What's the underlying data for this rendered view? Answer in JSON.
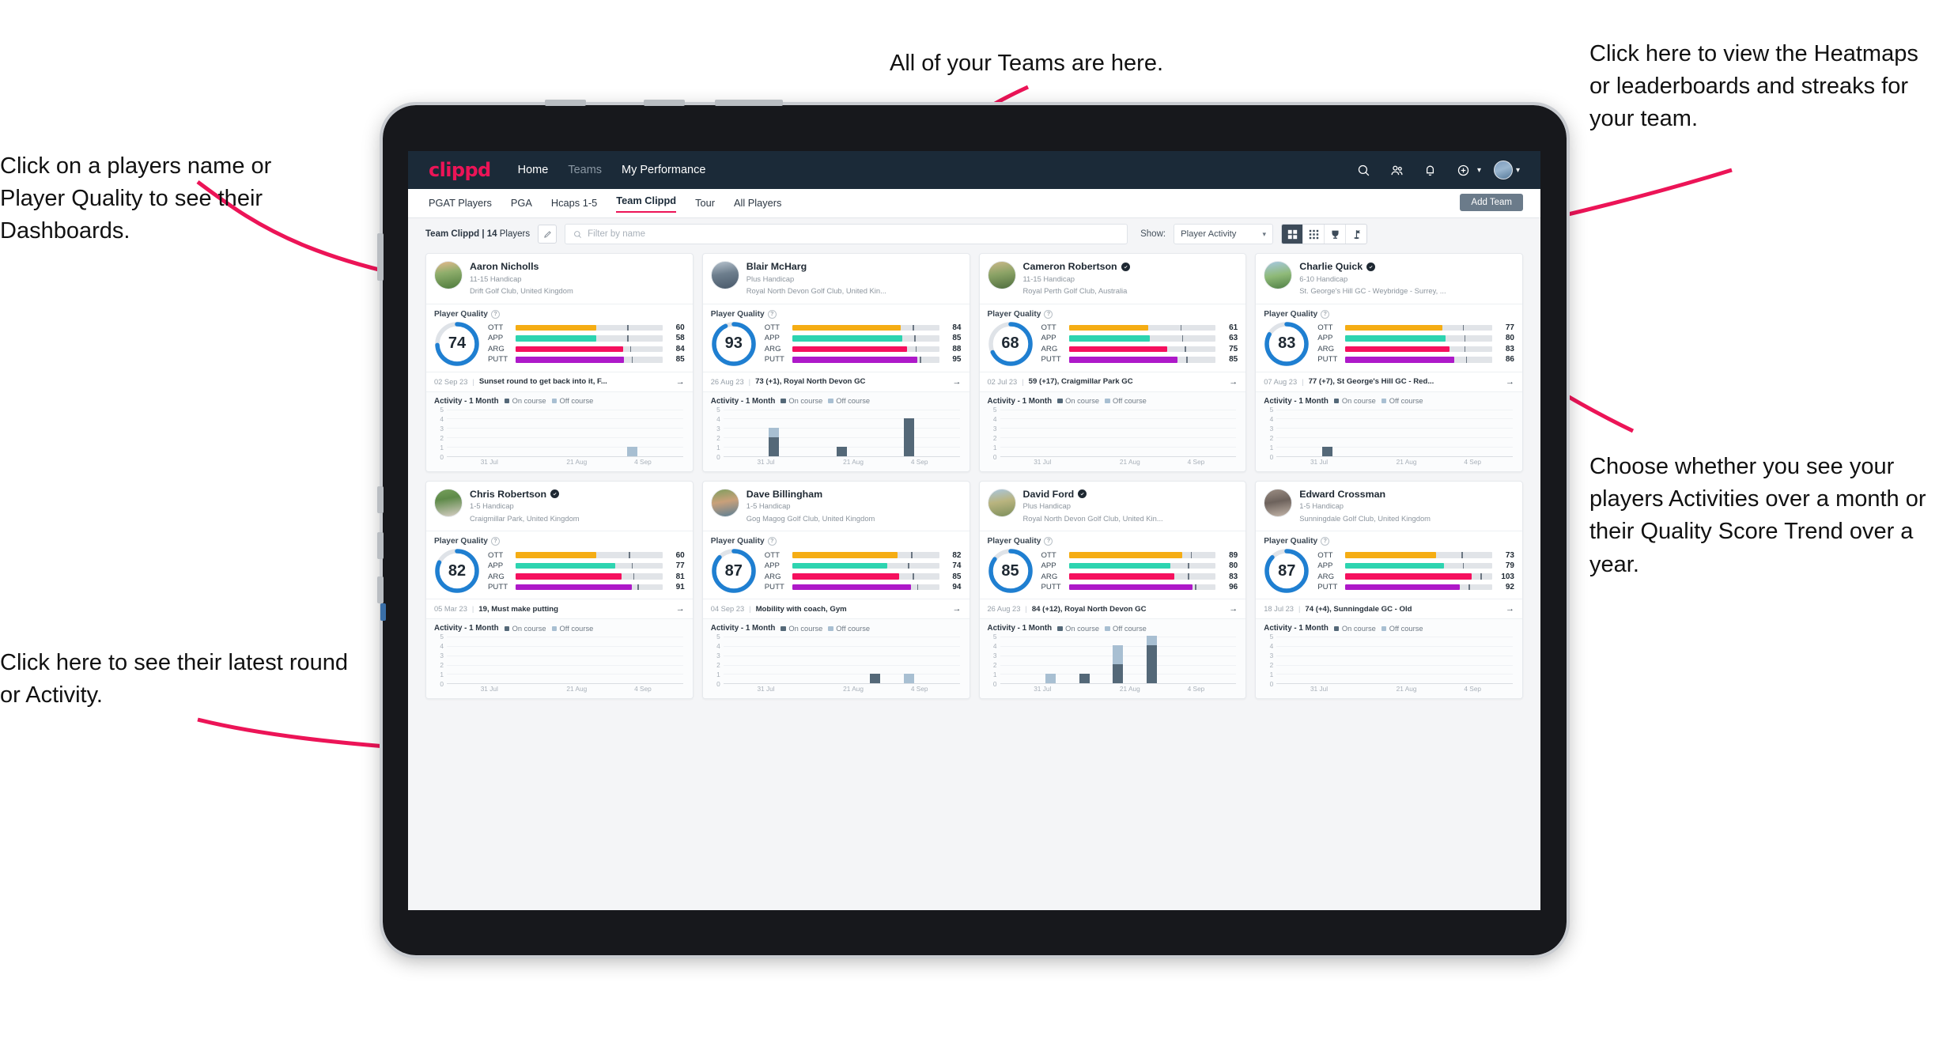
{
  "annotations": {
    "players_name": "Click on a players name or Player Quality to see their Dashboards.",
    "teams": "All of your Teams are here.",
    "heatmaps": "Click here to view the Heatmaps or leaderboards and streaks for your team.",
    "activity_choice": "Choose whether you see your players Activities over a month or their Quality Score Trend over a year.",
    "latest_round": "Click here to see their latest round or Activity."
  },
  "app": {
    "logo": "clippd",
    "nav": [
      {
        "label": "Home",
        "active": true
      },
      {
        "label": "Teams",
        "active": false
      },
      {
        "label": "My Performance",
        "active": true
      }
    ],
    "nav_icons": [
      "search-icon",
      "people-icon",
      "bell-icon",
      "plus-circle-icon",
      "avatar"
    ],
    "subtabs": [
      {
        "label": "PGAT Players",
        "state": "normal"
      },
      {
        "label": "PGA",
        "state": "normal"
      },
      {
        "label": "Hcaps 1-5",
        "state": "normal"
      },
      {
        "label": "Team Clippd",
        "state": "active"
      },
      {
        "label": "Tour",
        "state": "normal"
      },
      {
        "label": "All Players",
        "state": "normal"
      }
    ],
    "add_team_label": "Add Team"
  },
  "toolbar": {
    "team_label_bold": "Team Clippd | 14",
    "team_label_rest": " Players",
    "edit_icon": "pencil-icon",
    "search_placeholder": "Filter by name",
    "show_label": "Show:",
    "show_value": "Player Activity",
    "view_buttons": [
      "grid-large-icon",
      "grid-small-icon",
      "trophy-icon",
      "golf-flag-icon"
    ]
  },
  "card_labels": {
    "player_quality": "Player Quality",
    "activity_title": "Activity - 1 Month",
    "legend_on": "On course",
    "legend_off": "Off course",
    "metric_names": [
      "OTT",
      "APP",
      "ARG",
      "PUTT"
    ],
    "x_ticks": [
      "31 Jul",
      "21 Aug",
      "4 Sep"
    ],
    "y_ticks": [
      "5",
      "4",
      "3",
      "2",
      "1",
      "0"
    ]
  },
  "colors": {
    "brand_pink": "#ec1457",
    "nav_dark": "#1b2a38",
    "ring_blue": "#1f7fd1",
    "ott": "#f5ad14",
    "app": "#2dd4b0",
    "arg": "#f5105e",
    "putt": "#ae19c9",
    "on_course": "#546878",
    "off_course": "#a8bfd2",
    "annotation_arrow": "#ec1457"
  },
  "players": [
    {
      "name": "Aaron Nicholls",
      "verified": false,
      "handicap": "11-15 Handicap",
      "club": "Drift Golf Club, United Kingdom",
      "quality": 74,
      "metrics": [
        {
          "name": "OTT",
          "value": 60,
          "fill": 55,
          "tick": 76
        },
        {
          "name": "APP",
          "value": 58,
          "fill": 55,
          "tick": 76
        },
        {
          "name": "ARG",
          "value": 84,
          "fill": 73,
          "tick": 78
        },
        {
          "name": "PUTT",
          "value": 85,
          "fill": 74,
          "tick": 79
        }
      ],
      "round": {
        "date": "02 Sep 23",
        "text": "Sunset round to get back into it, F..."
      },
      "activity": {
        "on": [
          0,
          0,
          0,
          0,
          0,
          0,
          0
        ],
        "off": [
          0,
          0,
          0,
          0,
          0,
          1,
          0
        ]
      },
      "avatar": "linear-gradient(170deg,#e7b98e 0%,#8fae6c 40%,#4d7a3c 100%)"
    },
    {
      "name": "Blair McHarg",
      "verified": false,
      "handicap": "Plus Handicap",
      "club": "Royal North Devon Golf Club, United Kin...",
      "quality": 93,
      "metrics": [
        {
          "name": "OTT",
          "value": 84,
          "fill": 74,
          "tick": 82
        },
        {
          "name": "APP",
          "value": 85,
          "fill": 75,
          "tick": 83
        },
        {
          "name": "ARG",
          "value": 88,
          "fill": 78,
          "tick": 84
        },
        {
          "name": "PUTT",
          "value": 95,
          "fill": 85,
          "tick": 87
        }
      ],
      "round": {
        "date": "26 Aug 23",
        "text": "73 (+1), Royal North Devon GC"
      },
      "activity": {
        "on": [
          0,
          2,
          0,
          1,
          0,
          4,
          0
        ],
        "off": [
          0,
          1,
          0,
          0,
          0,
          0,
          0
        ]
      },
      "avatar": "linear-gradient(170deg,#b8c4cf 0%,#6d7e8d 45%,#49596a 100%)"
    },
    {
      "name": "Cameron Robertson",
      "verified": true,
      "handicap": "11-15 Handicap",
      "club": "Royal Perth Golf Club, Australia",
      "quality": 68,
      "metrics": [
        {
          "name": "OTT",
          "value": 61,
          "fill": 54,
          "tick": 76
        },
        {
          "name": "APP",
          "value": 63,
          "fill": 55,
          "tick": 77
        },
        {
          "name": "ARG",
          "value": 75,
          "fill": 67,
          "tick": 79
        },
        {
          "name": "PUTT",
          "value": 85,
          "fill": 74,
          "tick": 80
        }
      ],
      "round": {
        "date": "02 Jul 23",
        "text": "59 (+17), Craigmillar Park GC"
      },
      "activity": {
        "on": [
          0,
          0,
          0,
          0,
          0,
          0,
          0
        ],
        "off": [
          0,
          0,
          0,
          0,
          0,
          0,
          0
        ]
      },
      "avatar": "linear-gradient(170deg,#cbb98a 0%,#8aa265 45%,#4e6d3e 100%)"
    },
    {
      "name": "Charlie Quick",
      "verified": true,
      "handicap": "6-10 Handicap",
      "club": "St. George's Hill GC - Weybridge - Surrey, ...",
      "quality": 83,
      "metrics": [
        {
          "name": "OTT",
          "value": 77,
          "fill": 66,
          "tick": 80
        },
        {
          "name": "APP",
          "value": 80,
          "fill": 68,
          "tick": 81
        },
        {
          "name": "ARG",
          "value": 83,
          "fill": 71,
          "tick": 81
        },
        {
          "name": "PUTT",
          "value": 86,
          "fill": 74,
          "tick": 82
        }
      ],
      "round": {
        "date": "07 Aug 23",
        "text": "77 (+7), St George's Hill GC - Red..."
      },
      "activity": {
        "on": [
          0,
          1,
          0,
          0,
          0,
          0,
          0
        ],
        "off": [
          0,
          0,
          0,
          0,
          0,
          0,
          0
        ]
      },
      "avatar": "linear-gradient(170deg,#a7c9e3 0%,#8fba78 50%,#4f7f45 100%)"
    },
    {
      "name": "Chris Robertson",
      "verified": true,
      "handicap": "1-5 Handicap",
      "club": "Craigmillar Park, United Kingdom",
      "quality": 82,
      "metrics": [
        {
          "name": "OTT",
          "value": 60,
          "fill": 55,
          "tick": 77
        },
        {
          "name": "APP",
          "value": 77,
          "fill": 68,
          "tick": 79
        },
        {
          "name": "ARG",
          "value": 81,
          "fill": 72,
          "tick": 80
        },
        {
          "name": "PUTT",
          "value": 91,
          "fill": 79,
          "tick": 83
        }
      ],
      "round": {
        "date": "05 Mar 23",
        "text": "19, Must make putting"
      },
      "activity": {
        "on": [
          0,
          0,
          0,
          0,
          0,
          0,
          0
        ],
        "off": [
          0,
          0,
          0,
          0,
          0,
          0,
          0
        ]
      },
      "avatar": "linear-gradient(170deg,#77a05c 0%,#5e8a49 35%,#d8cfc6 100%)"
    },
    {
      "name": "Dave Billingham",
      "verified": false,
      "handicap": "1-5 Handicap",
      "club": "Gog Magog Golf Club, United Kingdom",
      "quality": 87,
      "metrics": [
        {
          "name": "OTT",
          "value": 82,
          "fill": 72,
          "tick": 81
        },
        {
          "name": "APP",
          "value": 74,
          "fill": 65,
          "tick": 79
        },
        {
          "name": "ARG",
          "value": 85,
          "fill": 73,
          "tick": 82
        },
        {
          "name": "PUTT",
          "value": 94,
          "fill": 81,
          "tick": 85
        }
      ],
      "round": {
        "date": "04 Sep 23",
        "text": "Mobility with coach, Gym"
      },
      "activity": {
        "on": [
          0,
          0,
          0,
          0,
          1,
          0,
          0
        ],
        "off": [
          0,
          0,
          0,
          0,
          0,
          1,
          0
        ]
      },
      "avatar": "linear-gradient(170deg,#7f9e5e 0%,#c9a07a 45%,#5b7f94 100%)"
    },
    {
      "name": "David Ford",
      "verified": true,
      "handicap": "Plus Handicap",
      "club": "Royal North Devon Golf Club, United Kin...",
      "quality": 85,
      "metrics": [
        {
          "name": "OTT",
          "value": 89,
          "fill": 77,
          "tick": 83
        },
        {
          "name": "APP",
          "value": 80,
          "fill": 69,
          "tick": 81
        },
        {
          "name": "ARG",
          "value": 83,
          "fill": 72,
          "tick": 81
        },
        {
          "name": "PUTT",
          "value": 96,
          "fill": 84,
          "tick": 86
        }
      ],
      "round": {
        "date": "26 Aug 23",
        "text": "84 (+12), Royal North Devon GC"
      },
      "activity": {
        "on": [
          0,
          0,
          1,
          2,
          4,
          0,
          0
        ],
        "off": [
          0,
          1,
          0,
          2,
          1,
          0,
          0
        ]
      },
      "avatar": "linear-gradient(170deg,#a9c6dd 0%,#b9b47f 45%,#7d8f5c 100%)"
    },
    {
      "name": "Edward Crossman",
      "verified": false,
      "handicap": "1-5 Handicap",
      "club": "Sunningdale Golf Club, United Kingdom",
      "quality": 87,
      "metrics": [
        {
          "name": "OTT",
          "value": 73,
          "fill": 62,
          "tick": 79
        },
        {
          "name": "APP",
          "value": 79,
          "fill": 67,
          "tick": 80
        },
        {
          "name": "ARG",
          "value": 103,
          "fill": 86,
          "tick": 92
        },
        {
          "name": "PUTT",
          "value": 92,
          "fill": 78,
          "tick": 84
        }
      ],
      "round": {
        "date": "18 Jul 23",
        "text": "74 (+4), Sunningdale GC - Old"
      },
      "activity": {
        "on": [
          0,
          0,
          0,
          0,
          0,
          0,
          0
        ],
        "off": [
          0,
          0,
          0,
          0,
          0,
          0,
          0
        ]
      },
      "avatar": "linear-gradient(170deg,#9c8e84 0%,#6d625c 45%,#c4b6aa 100%)"
    }
  ]
}
